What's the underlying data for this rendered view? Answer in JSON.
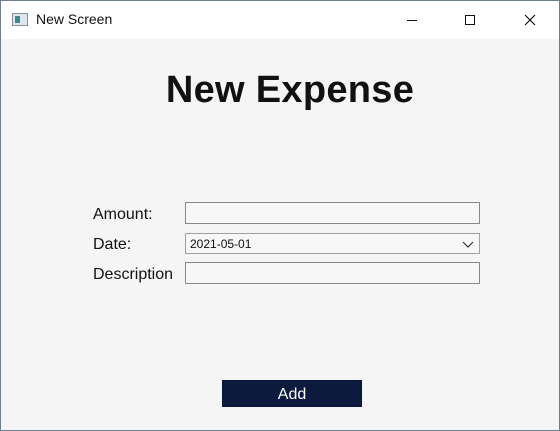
{
  "window": {
    "title": "New Screen",
    "controls": {
      "minimize": "minimize",
      "maximize": "maximize",
      "close": "close"
    }
  },
  "form": {
    "heading": "New Expense",
    "amount_label": "Amount:",
    "amount_value": "",
    "date_label": "Date:",
    "date_value": "2021-05-01",
    "description_label": "Description",
    "description_value": "",
    "submit_label": "Add"
  },
  "colors": {
    "background": "#f5f5f5",
    "button": "#0c1a3d",
    "button_text": "#ffffff"
  }
}
